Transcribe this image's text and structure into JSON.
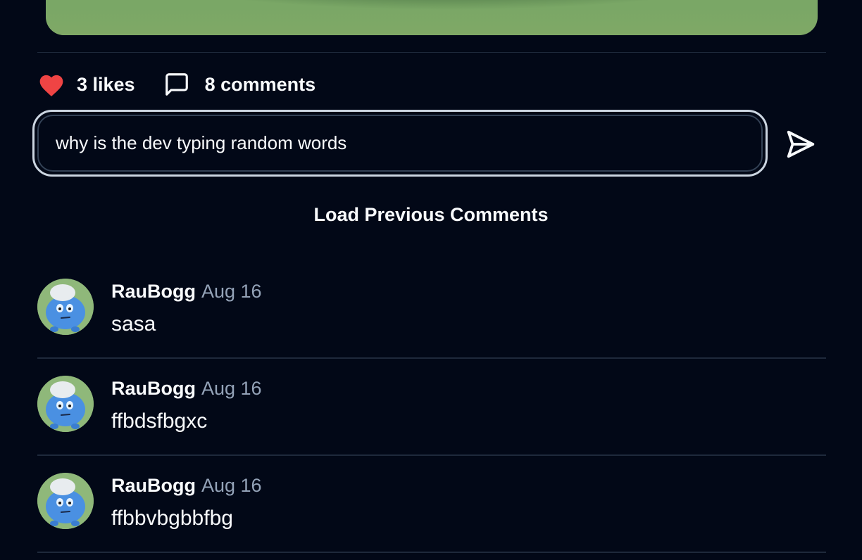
{
  "post": {
    "likes_label": "3 likes",
    "comments_label": "8 comments",
    "like_color": "#ef4444"
  },
  "comment_form": {
    "value": "why is the dev typing random words",
    "placeholder": ""
  },
  "load_previous_label": "Load Previous Comments",
  "comments": [
    {
      "author": "RauBogg",
      "date": "Aug 16",
      "text": "sasa"
    },
    {
      "author": "RauBogg",
      "date": "Aug 16",
      "text": "ffbdsfbgxc"
    },
    {
      "author": "RauBogg",
      "date": "Aug 16",
      "text": "ffbbvbgbbfbg"
    }
  ],
  "icons": {
    "like": "heart-icon",
    "comment": "message-square-icon",
    "send": "send-icon",
    "avatar": "blue-creature-avatar"
  },
  "colors": {
    "background": "#020817",
    "muted_text": "#94a3b8",
    "divider": "#1e293b"
  }
}
